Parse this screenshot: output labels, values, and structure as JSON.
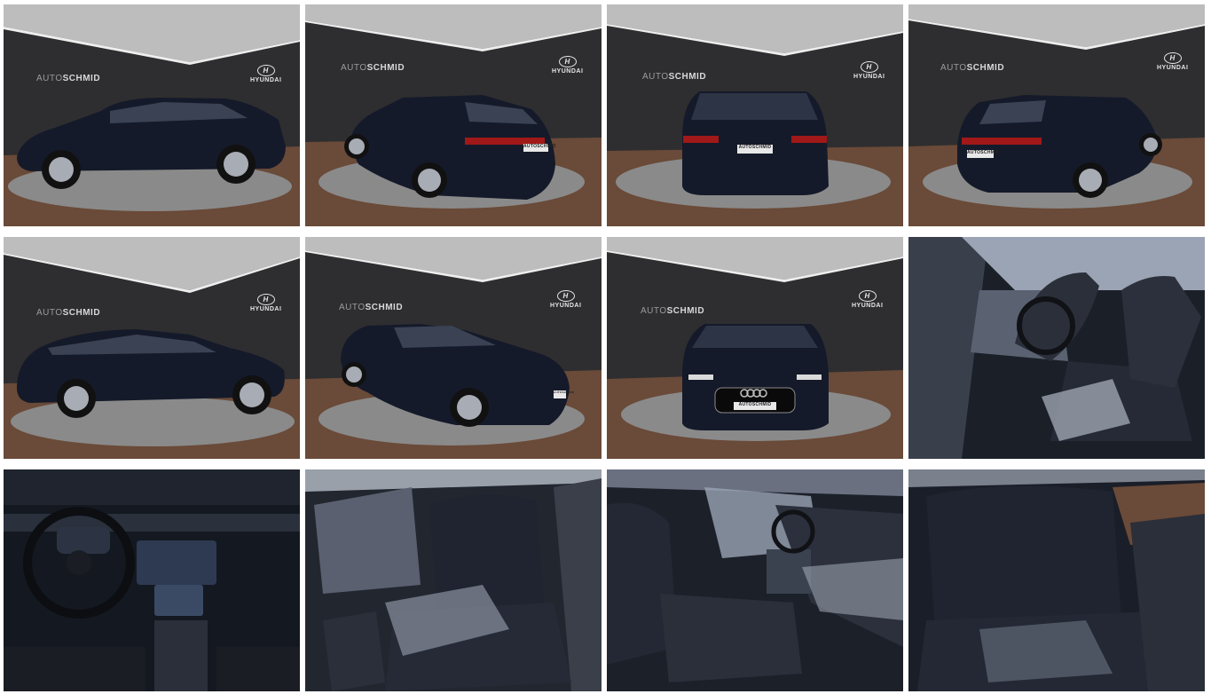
{
  "gallery": {
    "photos": [
      {
        "view": "side-left",
        "brand_text_prefix": "AUTO",
        "brand_text_bold": "SCHMID",
        "make_text": "HYUNDAI"
      },
      {
        "view": "rear-three-quarter-left",
        "brand_text_prefix": "AUTO",
        "brand_text_bold": "SCHMID",
        "make_text": "HYUNDAI",
        "plate_text": "AUTOSCHMID"
      },
      {
        "view": "rear",
        "brand_text_prefix": "AUTO",
        "brand_text_bold": "SCHMID",
        "make_text": "HYUNDAI",
        "plate_text": "AUTOSCHMID"
      },
      {
        "view": "rear-three-quarter-right",
        "brand_text_prefix": "AUTO",
        "brand_text_bold": "SCHMID",
        "make_text": "HYUNDAI",
        "plate_text": "AUTOSCHMID"
      },
      {
        "view": "side-right",
        "brand_text_prefix": "AUTO",
        "brand_text_bold": "SCHMID",
        "make_text": "HYUNDAI"
      },
      {
        "view": "front-three-quarter-left",
        "brand_text_prefix": "AUTO",
        "brand_text_bold": "SCHMID",
        "make_text": "HYUNDAI",
        "plate_text": "AUTOSCHMID"
      },
      {
        "view": "front",
        "brand_text_prefix": "AUTO",
        "brand_text_bold": "SCHMID",
        "make_text": "HYUNDAI",
        "plate_text": "AUTOSCHMID"
      },
      {
        "view": "interior-front-seats-door-open"
      },
      {
        "view": "interior-dashboard"
      },
      {
        "view": "interior-rear-seats"
      },
      {
        "view": "interior-front-seats-side"
      },
      {
        "view": "interior-rear-bench"
      }
    ]
  },
  "colors": {
    "background": "#ffffff",
    "showroom_wall": "#2e2e30",
    "ceiling": "#bfbfbf",
    "floor": "#6a4a38",
    "turntable": "#8a8a8a",
    "car_body": "#151a2a",
    "seat_fabric": "#1f2430"
  }
}
